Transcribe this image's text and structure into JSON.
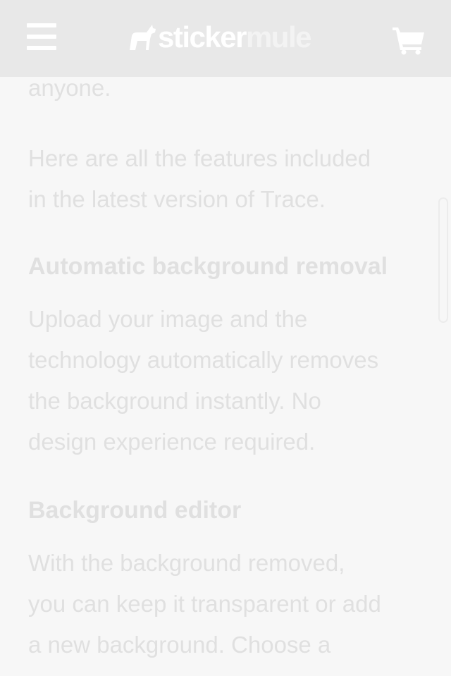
{
  "header": {
    "logo_word1": "sticker",
    "logo_word2": "mule"
  },
  "article": {
    "intro_tail": "anyone.",
    "features_intro_lines": [
      "Here are all the features included",
      "in the latest version of Trace."
    ],
    "sections": [
      {
        "heading": "Automatic background removal",
        "body_lines": [
          "Upload your image and the",
          "technology automatically removes",
          "the background instantly. No",
          "design experience required."
        ]
      },
      {
        "heading": "Background editor",
        "body_lines": [
          "With the background removed,",
          "you can keep it transparent or add",
          "a new background. Choose a"
        ]
      }
    ]
  },
  "icons": {
    "menu": "hamburger-menu-icon",
    "logo": "mule-logo-icon",
    "cart": "shopping-cart-icon"
  },
  "colors": {
    "header_bg": "#e8e8e8",
    "page_bg": "#f7f7f7",
    "text": "#e0e0e0"
  }
}
